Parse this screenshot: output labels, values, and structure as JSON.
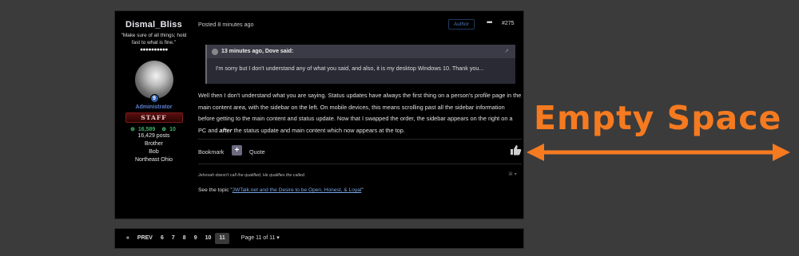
{
  "author": {
    "name": "Dismal_Bliss",
    "tagline": "\"Make sure of all things; hold fast to what is fine.\"",
    "rating_dots": "●●●●●●●●●●",
    "badge_text": "9",
    "role": "Administrator",
    "staff_label": "STAFF",
    "reputation": "16,589",
    "rep_secondary": "10",
    "posts": "16,429 posts",
    "title_line": "Brother",
    "first_name": "Bob",
    "location": "Northeast Ohio"
  },
  "post": {
    "posted": "Posted 8 minutes ago",
    "author_badge": "Author",
    "more_icon": "•••",
    "number": "#275",
    "quote": {
      "attribution": "13 minutes ago, Dove said:",
      "text": "I'm sorry but I don't understand any of what you said, and also, it is my desktop Windows 10. Thank you..."
    },
    "body_part1": "Well then I don't understand what you are saying. Status updates have always the first thing on a person's profile page in the main content area, with the sidebar on the left. On mobile devices, this means scrolling past all the sidebar information before getting to the main content and status update. Now that I swapped the order, the sidebar appears on the right on a PC and ",
    "body_emph": "after",
    "body_part2": " the status update and main content which now appears at the top.",
    "bookmark_label": "Bookmark",
    "plus_label": "+",
    "quote_label": "Quote",
    "signature": "Jehovah doesn't call the qualified, He qualifies the called.",
    "sig_ctl": "⌘ ▾",
    "topic_prefix": "See the topic \"",
    "topic_link": "JWTalk.net and the Desire to be Open, Honest, & Loyal",
    "topic_suffix": "\""
  },
  "pagination": {
    "first": "«",
    "prev": "PREV",
    "pages": [
      "6",
      "7",
      "8",
      "9",
      "10",
      "11"
    ],
    "current": "11",
    "page_of": "Page 11 of 11 ▾"
  },
  "annotation": {
    "label": "Empty Space",
    "color": "#f57a20"
  }
}
